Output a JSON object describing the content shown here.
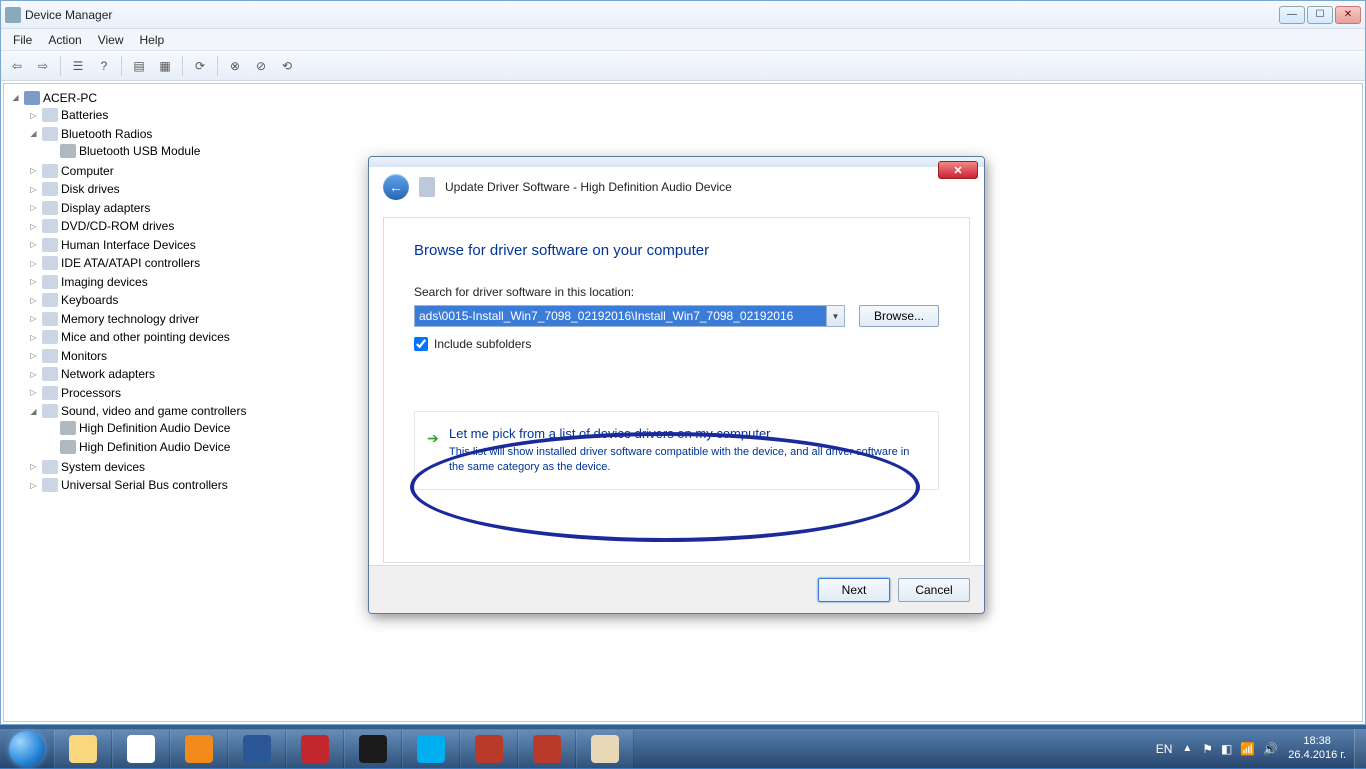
{
  "window": {
    "title": "Device Manager",
    "menus": [
      "File",
      "Action",
      "View",
      "Help"
    ]
  },
  "tree": {
    "root": "ACER-PC",
    "nodes": [
      {
        "label": "Batteries",
        "expanded": false
      },
      {
        "label": "Bluetooth Radios",
        "expanded": true,
        "children": [
          {
            "label": "Bluetooth USB Module"
          }
        ]
      },
      {
        "label": "Computer",
        "expanded": false
      },
      {
        "label": "Disk drives",
        "expanded": false
      },
      {
        "label": "Display adapters",
        "expanded": false
      },
      {
        "label": "DVD/CD-ROM drives",
        "expanded": false
      },
      {
        "label": "Human Interface Devices",
        "expanded": false
      },
      {
        "label": "IDE ATA/ATAPI controllers",
        "expanded": false
      },
      {
        "label": "Imaging devices",
        "expanded": false
      },
      {
        "label": "Keyboards",
        "expanded": false
      },
      {
        "label": "Memory technology driver",
        "expanded": false
      },
      {
        "label": "Mice and other pointing devices",
        "expanded": false
      },
      {
        "label": "Monitors",
        "expanded": false
      },
      {
        "label": "Network adapters",
        "expanded": false
      },
      {
        "label": "Processors",
        "expanded": false
      },
      {
        "label": "Sound, video and game controllers",
        "expanded": true,
        "children": [
          {
            "label": "High Definition Audio Device"
          },
          {
            "label": "High Definition Audio Device"
          }
        ]
      },
      {
        "label": "System devices",
        "expanded": false
      },
      {
        "label": "Universal Serial Bus controllers",
        "expanded": false
      }
    ]
  },
  "dialog": {
    "header": "Update Driver Software - High Definition Audio Device",
    "heading": "Browse for driver software on your computer",
    "search_label": "Search for driver software in this location:",
    "path_value": "ads\\0015-Install_Win7_7098_02192016\\Install_Win7_7098_02192016",
    "browse_label": "Browse...",
    "include_subfolders": "Include subfolders",
    "include_checked": true,
    "option_title": "Let me pick from a list of device drivers on my computer",
    "option_desc": "This list will show installed driver software compatible with the device, and all driver software in the same category as the device.",
    "next": "Next",
    "cancel": "Cancel"
  },
  "taskbar": {
    "apps": [
      {
        "name": "explorer",
        "color": "#f9d77e"
      },
      {
        "name": "chrome",
        "color": "#ffffff"
      },
      {
        "name": "vlc",
        "color": "#f28a1c"
      },
      {
        "name": "word",
        "color": "#2b5797"
      },
      {
        "name": "comodo",
        "color": "#c1272d"
      },
      {
        "name": "lol",
        "color": "#1b1b1b"
      },
      {
        "name": "skype",
        "color": "#00aff0"
      },
      {
        "name": "toolbox1",
        "color": "#b93a2b"
      },
      {
        "name": "toolbox2",
        "color": "#b93a2b"
      },
      {
        "name": "paint",
        "color": "#e8d8b8"
      }
    ],
    "lang": "EN",
    "time": "18:38",
    "date": "26.4.2016 г."
  }
}
